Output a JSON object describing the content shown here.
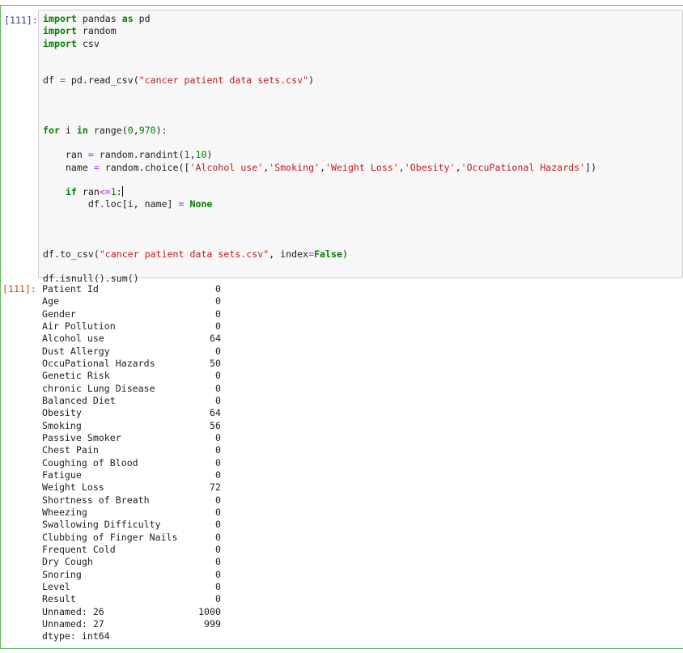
{
  "input_prompt": "[111]:",
  "output_prompt": "[111]:",
  "code": {
    "l1": [
      "import",
      " pandas ",
      "as",
      " pd"
    ],
    "l2": [
      "import",
      " random"
    ],
    "l3": [
      "import",
      " csv"
    ],
    "l4": [
      "df ",
      "=",
      " pd.read_csv(",
      "\"cancer patient data sets.csv\"",
      ")"
    ],
    "l5": [
      "for",
      " i ",
      "in",
      " range(",
      "0",
      ",",
      "970",
      "):"
    ],
    "l6": [
      "    ran ",
      "=",
      " random.randint(",
      "1",
      ",",
      "10",
      ")"
    ],
    "l7": [
      "    name ",
      "=",
      " random.choice([",
      "'Alcohol use'",
      ",",
      "'Smoking'",
      ",",
      "'Weight Loss'",
      ",",
      "'Obesity'",
      ",",
      "'OccuPational Hazards'",
      "])"
    ],
    "l8": [
      "    ",
      "if",
      " ran",
      "<=",
      "1",
      ":"
    ],
    "l9": [
      "        df.loc[i, name] ",
      "=",
      " ",
      "None"
    ],
    "l10": [
      "df.to_csv(",
      "\"cancer patient data sets.csv\"",
      ", index",
      "=",
      "False",
      ")"
    ],
    "l11": [
      "df.isnull().sum()"
    ]
  },
  "output_rows": [
    {
      "name": "Patient Id",
      "value": "0"
    },
    {
      "name": "Age",
      "value": "0"
    },
    {
      "name": "Gender",
      "value": "0"
    },
    {
      "name": "Air Pollution",
      "value": "0"
    },
    {
      "name": "Alcohol use",
      "value": "64"
    },
    {
      "name": "Dust Allergy",
      "value": "0"
    },
    {
      "name": "OccuPational Hazards",
      "value": "50"
    },
    {
      "name": "Genetic Risk",
      "value": "0"
    },
    {
      "name": "chronic Lung Disease",
      "value": "0"
    },
    {
      "name": "Balanced Diet",
      "value": "0"
    },
    {
      "name": "Obesity",
      "value": "64"
    },
    {
      "name": "Smoking",
      "value": "56"
    },
    {
      "name": "Passive Smoker",
      "value": "0"
    },
    {
      "name": "Chest Pain",
      "value": "0"
    },
    {
      "name": "Coughing of Blood",
      "value": "0"
    },
    {
      "name": "Fatigue",
      "value": "0"
    },
    {
      "name": "Weight Loss",
      "value": "72"
    },
    {
      "name": "Shortness of Breath",
      "value": "0"
    },
    {
      "name": "Wheezing",
      "value": "0"
    },
    {
      "name": "Swallowing Difficulty",
      "value": "0"
    },
    {
      "name": "Clubbing of Finger Nails",
      "value": "0"
    },
    {
      "name": "Frequent Cold",
      "value": "0"
    },
    {
      "name": "Dry Cough",
      "value": "0"
    },
    {
      "name": "Snoring",
      "value": "0"
    },
    {
      "name": "Level",
      "value": "0"
    },
    {
      "name": "Result",
      "value": "0"
    },
    {
      "name": "Unnamed: 26",
      "value": "1000"
    },
    {
      "name": "Unnamed: 27",
      "value": "999"
    }
  ],
  "dtype_line": "dtype: int64",
  "colors": {
    "cell_border": "#66b466",
    "input_prompt": "#303f9f",
    "output_prompt": "#d84315",
    "keyword": "#008000",
    "string": "#ba2121",
    "operator": "#aa22ff",
    "input_bg": "#f7f7f7"
  }
}
